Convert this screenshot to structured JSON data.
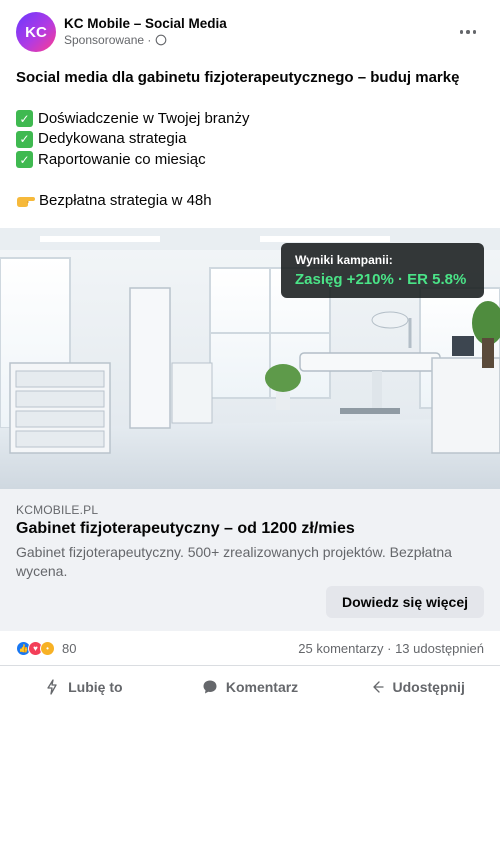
{
  "post": {
    "avatar_initials": "KC",
    "page_name": "KC Mobile – Social Media",
    "sponsored_label": "Sponsorowane ·",
    "headline": "Social media dla gabinetu fizjoterapeutycznego – buduj markę",
    "bullets": [
      "Doświadczenie w Twojej branży",
      "Dedykowana strategia",
      "Raportowanie co miesiąc"
    ],
    "cta_line": "Bezpłatna strategia w 48h"
  },
  "image": {
    "badge_label": "Wyniki kampanii:",
    "badge_value": "Zasięg +210% · ER 5.8%"
  },
  "link": {
    "domain": "KCMOBILE.PL",
    "title": "Gabinet fizjoterapeutyczny – od 1200 zł/mies",
    "description": "Gabinet fizjoterapeutyczny. 500+ zrealizowanych projektów. Bezpłatna wycena.",
    "button_label": "Dowiedz się więcej"
  },
  "engagement": {
    "reaction_count": "80",
    "stats": "25 komentarzy · 13 udostępnień"
  },
  "actions": {
    "like_label": "Lubię to",
    "comment_label": "Komentarz",
    "share_label": "Udostępnij"
  },
  "colors": {
    "accent_green": "#4ae387",
    "link_bg": "#f0f2f5",
    "muted_text": "#65676b"
  }
}
